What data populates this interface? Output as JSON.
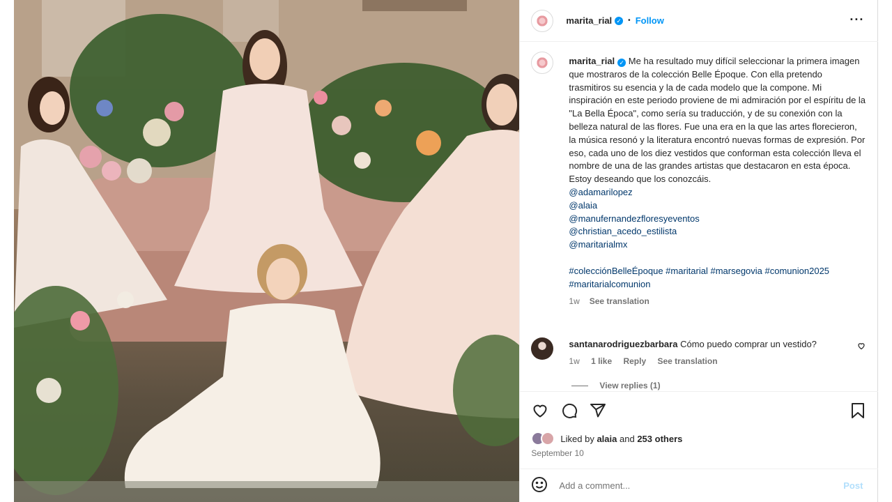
{
  "post": {
    "author": "marita_rial",
    "follow_label": "Follow",
    "separator": "•",
    "more_icon": "more-horizontal-icon",
    "image_alt": "Four girls in lace communion dresses posed around a pink velvet sofa surrounded by flowers"
  },
  "caption": {
    "author": "marita_rial",
    "text": "Me ha resultado muy difícil seleccionar la primera imagen que mostraros de la colección Belle Époque. Con ella pretendo trasmitiros su esencia y la de cada modelo que la compone. Mi inspiración en este periodo proviene de mi admiración por el espíritu de la \"La Bella Época\", como sería su traducción, y de su conexión con la belleza natural de las flores. Fue una era en la que las artes florecieron, la música resonó y la literatura encontró nuevas formas de expresión. Por eso, cada uno de los diez vestidos que conforman esta colección lleva el nombre de una de las grandes artistas que destacaron en esta época. Estoy deseando que los conozcáis.",
    "mentions": [
      "@adamarilopez",
      "@alaia",
      "@manufernandezfloresyeventos",
      "@christian_acedo_estilista",
      "@maritarialmx"
    ],
    "hashtags_line1": "#colecciónBelleÉpoque #maritarial #marsegovia #comunion2025",
    "hashtags_line2": "#maritarialcomunion",
    "time": "1w",
    "see_translation": "See translation"
  },
  "comment": {
    "author": "santanarodriguezbarbara",
    "text": "Cómo puedo comprar un vestido?",
    "time": "1w",
    "likes": "1 like",
    "reply": "Reply",
    "see_translation": "See translation",
    "view_replies": "View replies (1)"
  },
  "actions": {
    "icons": [
      "heart-icon",
      "comment-icon",
      "share-icon",
      "bookmark-icon"
    ]
  },
  "likes": {
    "prefix": "Liked by",
    "user": "alaia",
    "middle": "and",
    "count": "253 others"
  },
  "date": "September 10",
  "add_comment": {
    "placeholder": "Add a comment...",
    "post_label": "Post"
  }
}
